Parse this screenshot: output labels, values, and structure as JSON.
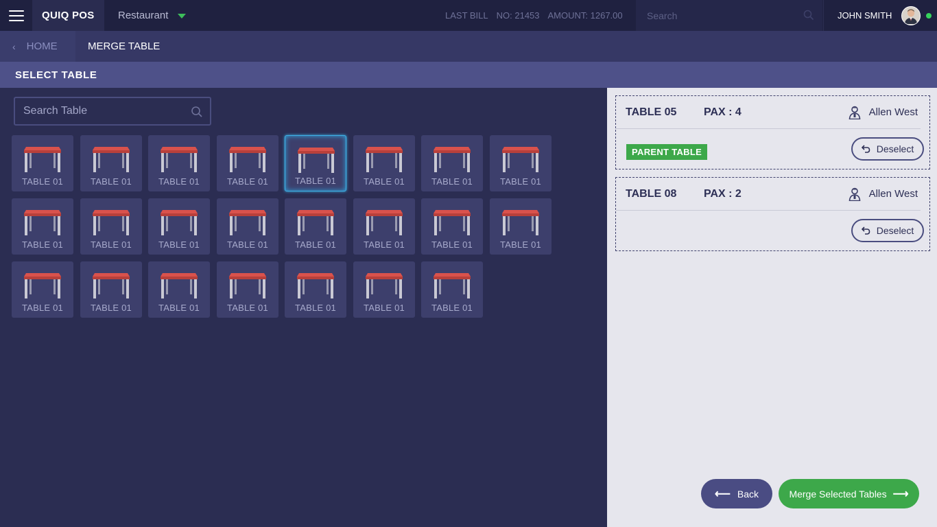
{
  "topbar": {
    "brand": "QUIQ POS",
    "outlet": "Restaurant",
    "last_bill_label": "LAST BILL",
    "bill_no": "NO: 21453",
    "bill_amount": "AMOUNT: 1267.00",
    "search_placeholder": "Search",
    "user_name": "JOHN SMITH",
    "status_color": "#36d35c"
  },
  "breadcrumb": {
    "home": "HOME",
    "current": "MERGE TABLE"
  },
  "section_title": "SELECT TABLE",
  "table_search_placeholder": "Search Table",
  "tables": [
    {
      "label": "TABLE 01",
      "selected": false
    },
    {
      "label": "TABLE 01",
      "selected": false
    },
    {
      "label": "TABLE 01",
      "selected": false
    },
    {
      "label": "TABLE 01",
      "selected": false
    },
    {
      "label": "TABLE 01",
      "selected": true
    },
    {
      "label": "TABLE 01",
      "selected": false
    },
    {
      "label": "TABLE 01",
      "selected": false
    },
    {
      "label": "TABLE 01",
      "selected": false
    },
    {
      "label": "TABLE 01",
      "selected": false
    },
    {
      "label": "TABLE 01",
      "selected": false
    },
    {
      "label": "TABLE 01",
      "selected": false
    },
    {
      "label": "TABLE 01",
      "selected": false
    },
    {
      "label": "TABLE 01",
      "selected": false
    },
    {
      "label": "TABLE 01",
      "selected": false
    },
    {
      "label": "TABLE 01",
      "selected": false
    },
    {
      "label": "TABLE 01",
      "selected": false
    },
    {
      "label": "TABLE 01",
      "selected": false
    },
    {
      "label": "TABLE 01",
      "selected": false
    },
    {
      "label": "TABLE 01",
      "selected": false
    },
    {
      "label": "TABLE 01",
      "selected": false
    },
    {
      "label": "TABLE 01",
      "selected": false
    },
    {
      "label": "TABLE 01",
      "selected": false
    },
    {
      "label": "TABLE 01",
      "selected": false
    }
  ],
  "selected_tables": [
    {
      "name": "TABLE 05",
      "pax": "PAX : 4",
      "waiter": "Allen West",
      "badge": "PARENT TABLE",
      "action": "Deselect"
    },
    {
      "name": "TABLE 08",
      "pax": "PAX : 2",
      "waiter": "Allen West",
      "action": "Deselect"
    }
  ],
  "footer": {
    "back_label": "Back",
    "merge_label": "Merge Selected Tables"
  },
  "colors": {
    "accent_green": "#3da84a",
    "selection_blue": "#3fb3e8",
    "table_top": "#c94a45"
  }
}
